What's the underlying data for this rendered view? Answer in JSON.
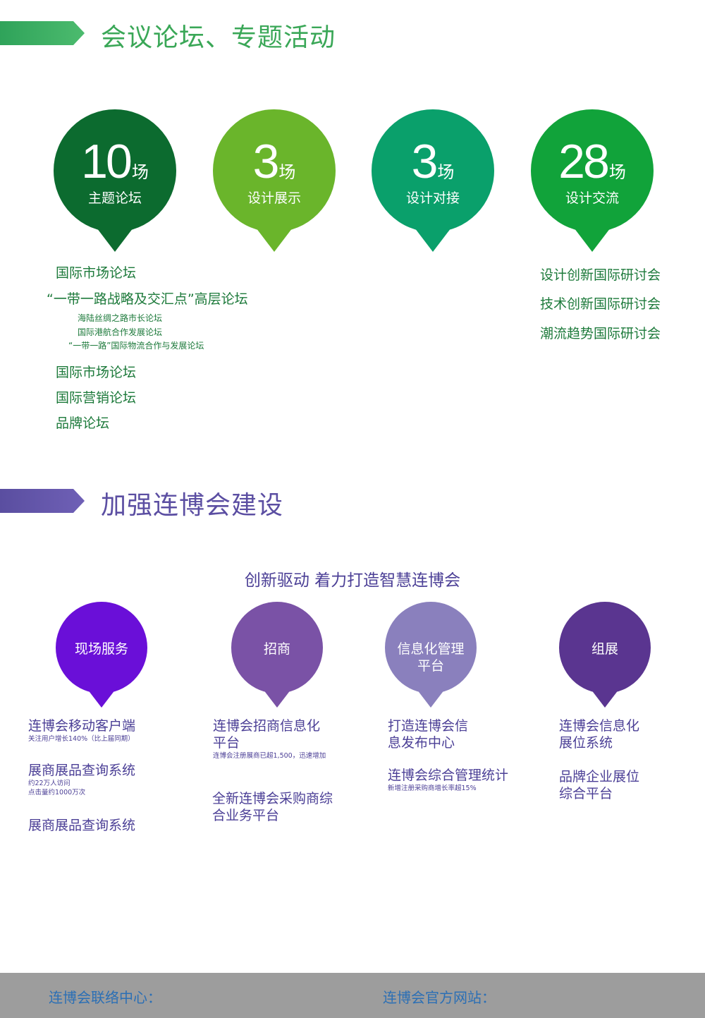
{
  "section1": {
    "title": "会议论坛、专题活动",
    "color": "#3aa757"
  },
  "forum_stats": [
    {
      "number": "10",
      "unit": "场",
      "label": "主题论坛",
      "color": "#0c6b2f"
    },
    {
      "number": "3",
      "unit": "场",
      "label": "设计展示",
      "color": "#6ab52b"
    },
    {
      "number": "3",
      "unit": "场",
      "label": "设计对接",
      "color": "#0aa06b"
    },
    {
      "number": "28",
      "unit": "场",
      "label": "设计交流",
      "color": "#11a33a"
    }
  ],
  "forum_list_left": {
    "item1": "国际市场论坛",
    "item2": "“一带一路战略及交汇点”高层论坛",
    "sub1": "海陆丝绸之路市长论坛",
    "sub2": "国际港航合作发展论坛",
    "sub3": "“一带一路”国际物流合作与发展论坛",
    "item3": "国际市场论坛",
    "item4": "国际营销论坛",
    "item5": "品牌论坛"
  },
  "forum_list_right": {
    "item1": "设计创新国际研讨会",
    "item2": "技术创新国际研讨会",
    "item3": "潮流趋势国际研讨会"
  },
  "section2": {
    "title": "加强连博会建设",
    "color": "#5b4ea2",
    "subtitle": "创新驱动 着力打造智慧连博会"
  },
  "build_pins": [
    {
      "label": "现场服务",
      "color": "#6a0fd8"
    },
    {
      "label": "招商",
      "color": "#7a52a6"
    },
    {
      "label": "信息化管理平台",
      "color": "#8a80bd"
    },
    {
      "label": "组展",
      "color": "#5a3590"
    }
  ],
  "col1": {
    "t1": "连博会移动客户端",
    "n1": "关注用户增长140%（比上届同期）",
    "t2": "展商展品查询系统",
    "n2a": "约22万人访问",
    "n2b": "点击量约1000万次",
    "t3": "展商展品查询系统"
  },
  "col2": {
    "t1": "连博会招商信息化平台",
    "n1": "连博会注册展商已超1,500，迅速增加",
    "t2": "全新连博会采购商综合业务平台"
  },
  "col3": {
    "t1": "打造连博会信息发布中心",
    "t2": "连博会综合管理统计",
    "n2": "新增注册采购商增长率超15%"
  },
  "col4": {
    "t1": "连博会信息化展位系统",
    "t2": "品牌企业展位综合平台"
  },
  "footer": {
    "contact_label": "连博会联络中心：",
    "website_label": "连博会官方网站："
  }
}
